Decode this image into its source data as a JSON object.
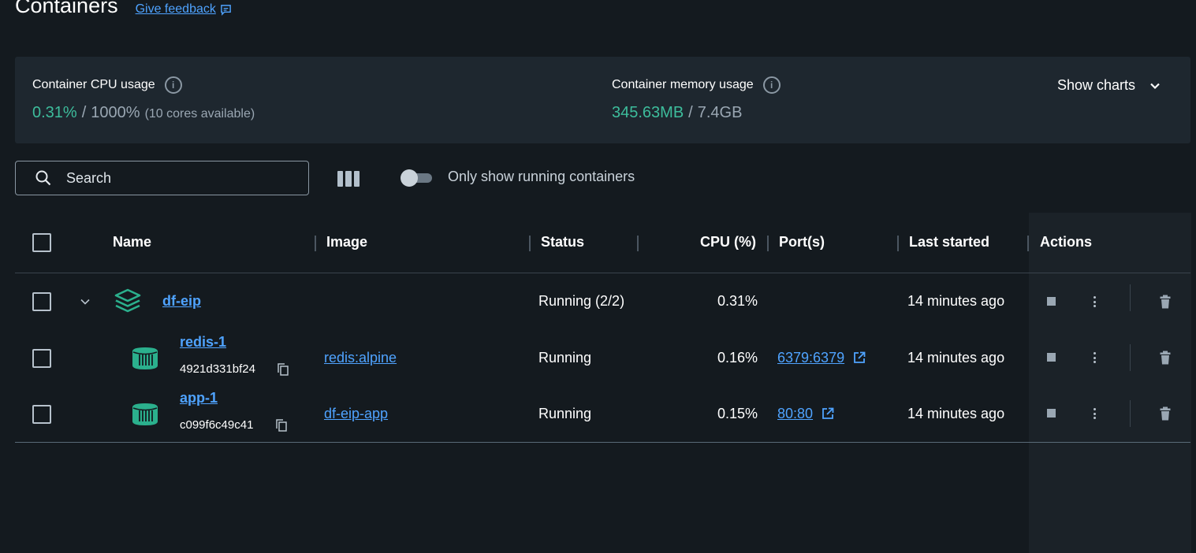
{
  "header": {
    "title": "Containers",
    "feedback_label": "Give feedback"
  },
  "usage": {
    "cpu": {
      "label": "Container CPU usage",
      "used": "0.31%",
      "separator": "/",
      "total": "1000%",
      "note": "(10 cores available)"
    },
    "memory": {
      "label": "Container memory usage",
      "used": "345.63MB",
      "separator": "/",
      "total": "7.4GB"
    },
    "show_charts_label": "Show charts"
  },
  "toolbar": {
    "search_placeholder": "Search",
    "toggle_label": "Only show running containers",
    "toggle_on": false
  },
  "table": {
    "columns": [
      "Name",
      "Image",
      "Status",
      "CPU (%)",
      "Port(s)",
      "Last started",
      "Actions"
    ],
    "rows": [
      {
        "name": "df-eip",
        "id": "",
        "image": "",
        "status": "Running (2/2)",
        "cpu": "0.31%",
        "port": "",
        "last_started": "14 minutes ago",
        "icon": "stack-icon"
      },
      {
        "name": "redis-1",
        "id": "4921d331bf24",
        "image": "redis:alpine",
        "status": "Running",
        "cpu": "0.16%",
        "port": "6379:6379",
        "last_started": "14 minutes ago",
        "icon": "container-icon"
      },
      {
        "name": "app-1",
        "id": "c099f6c49c41",
        "image": "df-eip-app",
        "status": "Running",
        "cpu": "0.15%",
        "port": "80:80",
        "last_started": "14 minutes ago",
        "icon": "container-icon"
      }
    ]
  },
  "colors": {
    "background": "#141a1f",
    "panel": "#1e272f",
    "accent_green": "#3dbd9c",
    "link_blue": "#4fa3ff"
  }
}
